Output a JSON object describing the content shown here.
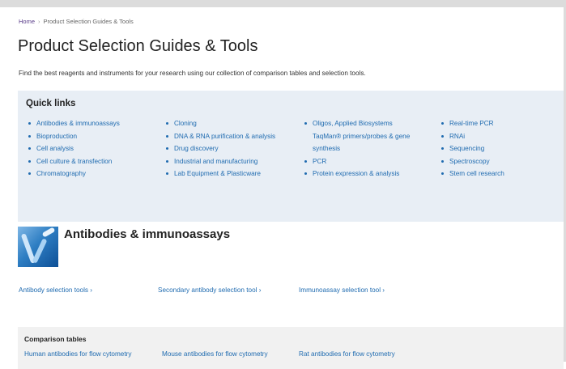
{
  "breadcrumb": {
    "home": "Home",
    "separator": "›",
    "current": "Product Selection Guides & Tools"
  },
  "page_title": "Product Selection Guides & Tools",
  "intro": "Find the best reagents and instruments for your research using our collection of comparison tables and selection tools.",
  "quick_links": {
    "heading": "Quick links",
    "col1": [
      "Antibodies & immunoassays",
      "Bioproduction",
      "Cell analysis",
      "Cell culture & transfection",
      "Chromatography"
    ],
    "col2": [
      "Cloning",
      "DNA & RNA purification & analysis",
      "Drug discovery",
      "Industrial and manufacturing",
      "Lab Equipment & Plasticware"
    ],
    "col3": [
      "Oligos, Applied Biosystems",
      "TaqMan® primers/probes & gene",
      "synthesis",
      "PCR",
      "Protein expression & analysis"
    ],
    "col4": [
      "Real-time PCR",
      "RNAi",
      "Sequencing",
      "Spectroscopy",
      "Stem cell research"
    ]
  },
  "section": {
    "title": "Antibodies & immunoassays",
    "tool_links": [
      "Antibody selection tools ›",
      "Secondary antibody selection tool ›",
      "Immunoassay selection tool ›"
    ]
  },
  "comparison": {
    "heading": "Comparison tables",
    "links": [
      "Human antibodies for flow cytometry",
      "Mouse antibodies for flow cytometry",
      "Rat antibodies for flow cytometry"
    ]
  },
  "colors": {
    "link": "#1f6bb0",
    "quick_links_bg": "#e8eef5",
    "comparison_bg": "#f1f1f1",
    "breadcrumb_home": "#5a3d8a"
  }
}
